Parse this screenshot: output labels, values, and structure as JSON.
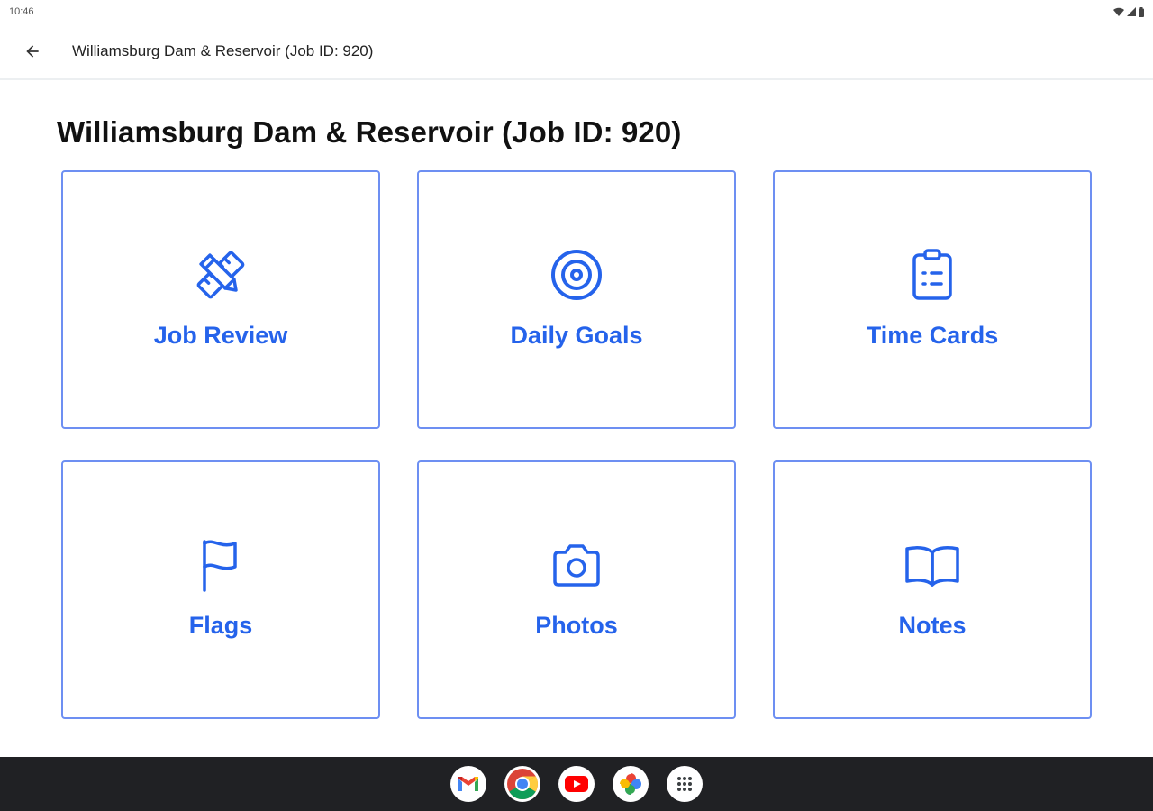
{
  "status_bar": {
    "time": "10:46"
  },
  "app_bar": {
    "title": "Williamsburg Dam & Reservoir (Job ID: 920)",
    "back_icon": "arrow-back-icon"
  },
  "page": {
    "title": "Williamsburg Dam & Reservoir (Job ID: 920)"
  },
  "tiles": [
    {
      "label": "Job Review",
      "icon": "pencil-ruler-icon"
    },
    {
      "label": "Daily Goals",
      "icon": "target-icon"
    },
    {
      "label": "Time Cards",
      "icon": "clipboard-list-icon"
    },
    {
      "label": "Flags",
      "icon": "flag-icon"
    },
    {
      "label": "Photos",
      "icon": "camera-icon"
    },
    {
      "label": "Notes",
      "icon": "book-open-icon"
    }
  ],
  "dock": {
    "apps": [
      {
        "name": "Gmail",
        "icon": "gmail-icon"
      },
      {
        "name": "Chrome",
        "icon": "chrome-icon"
      },
      {
        "name": "YouTube",
        "icon": "youtube-icon"
      },
      {
        "name": "Photos",
        "icon": "google-photos-icon"
      },
      {
        "name": "App drawer",
        "icon": "app-drawer-icon"
      }
    ]
  },
  "colors": {
    "accent": "#2563eb",
    "tile_border": "#6d8ff2",
    "dock_background": "#202124"
  }
}
